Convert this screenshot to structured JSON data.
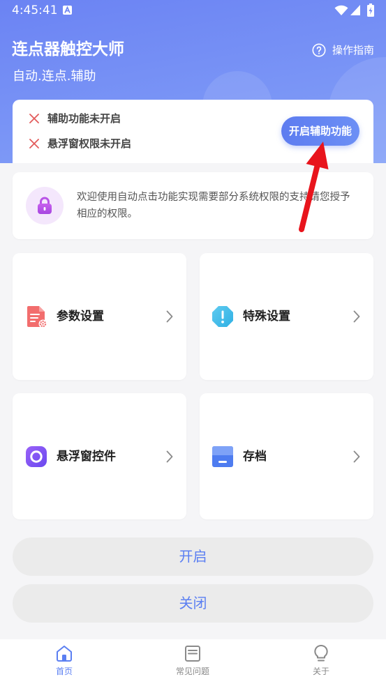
{
  "status_bar": {
    "time": "4:45:41",
    "icons": [
      "a-notification-icon",
      "wifi-icon",
      "signal-icon",
      "battery-charging-icon"
    ]
  },
  "header": {
    "title": "连点器触控大师",
    "subtitle": "自动.连点.辅助",
    "guide_icon": "question-circle-icon",
    "guide_label": "操作指南"
  },
  "permission_status": {
    "items": [
      {
        "icon": "close-icon",
        "label": "辅助功能未开启"
      },
      {
        "icon": "close-icon",
        "label": "悬浮窗权限未开启"
      }
    ],
    "enable_button": "开启辅助功能"
  },
  "notice": {
    "icon": "lock-icon",
    "text": "欢迎使用自动点击功能实现需要部分系统权限的支持请您授予相应的权限。"
  },
  "features": [
    {
      "label": "参数设置",
      "icon": "document-settings-icon"
    },
    {
      "label": "特殊设置",
      "icon": "warning-octagon-icon"
    },
    {
      "label": "悬浮窗控件",
      "icon": "floating-window-icon"
    },
    {
      "label": "存档",
      "icon": "save-icon"
    }
  ],
  "actions": {
    "start_label": "开启",
    "stop_label": "关闭"
  },
  "bottom_nav": {
    "items": [
      {
        "label": "首页",
        "icon": "home-icon",
        "active": true
      },
      {
        "label": "常见问题",
        "icon": "faq-icon",
        "active": false
      },
      {
        "label": "关于",
        "icon": "lightbulb-icon",
        "active": false
      }
    ]
  },
  "colors": {
    "accent": "#5b7ff2",
    "header_start": "#6b83f3",
    "header_end": "#84a1f8",
    "error": "#e25b5b",
    "page_bg": "#f5f5f7"
  }
}
